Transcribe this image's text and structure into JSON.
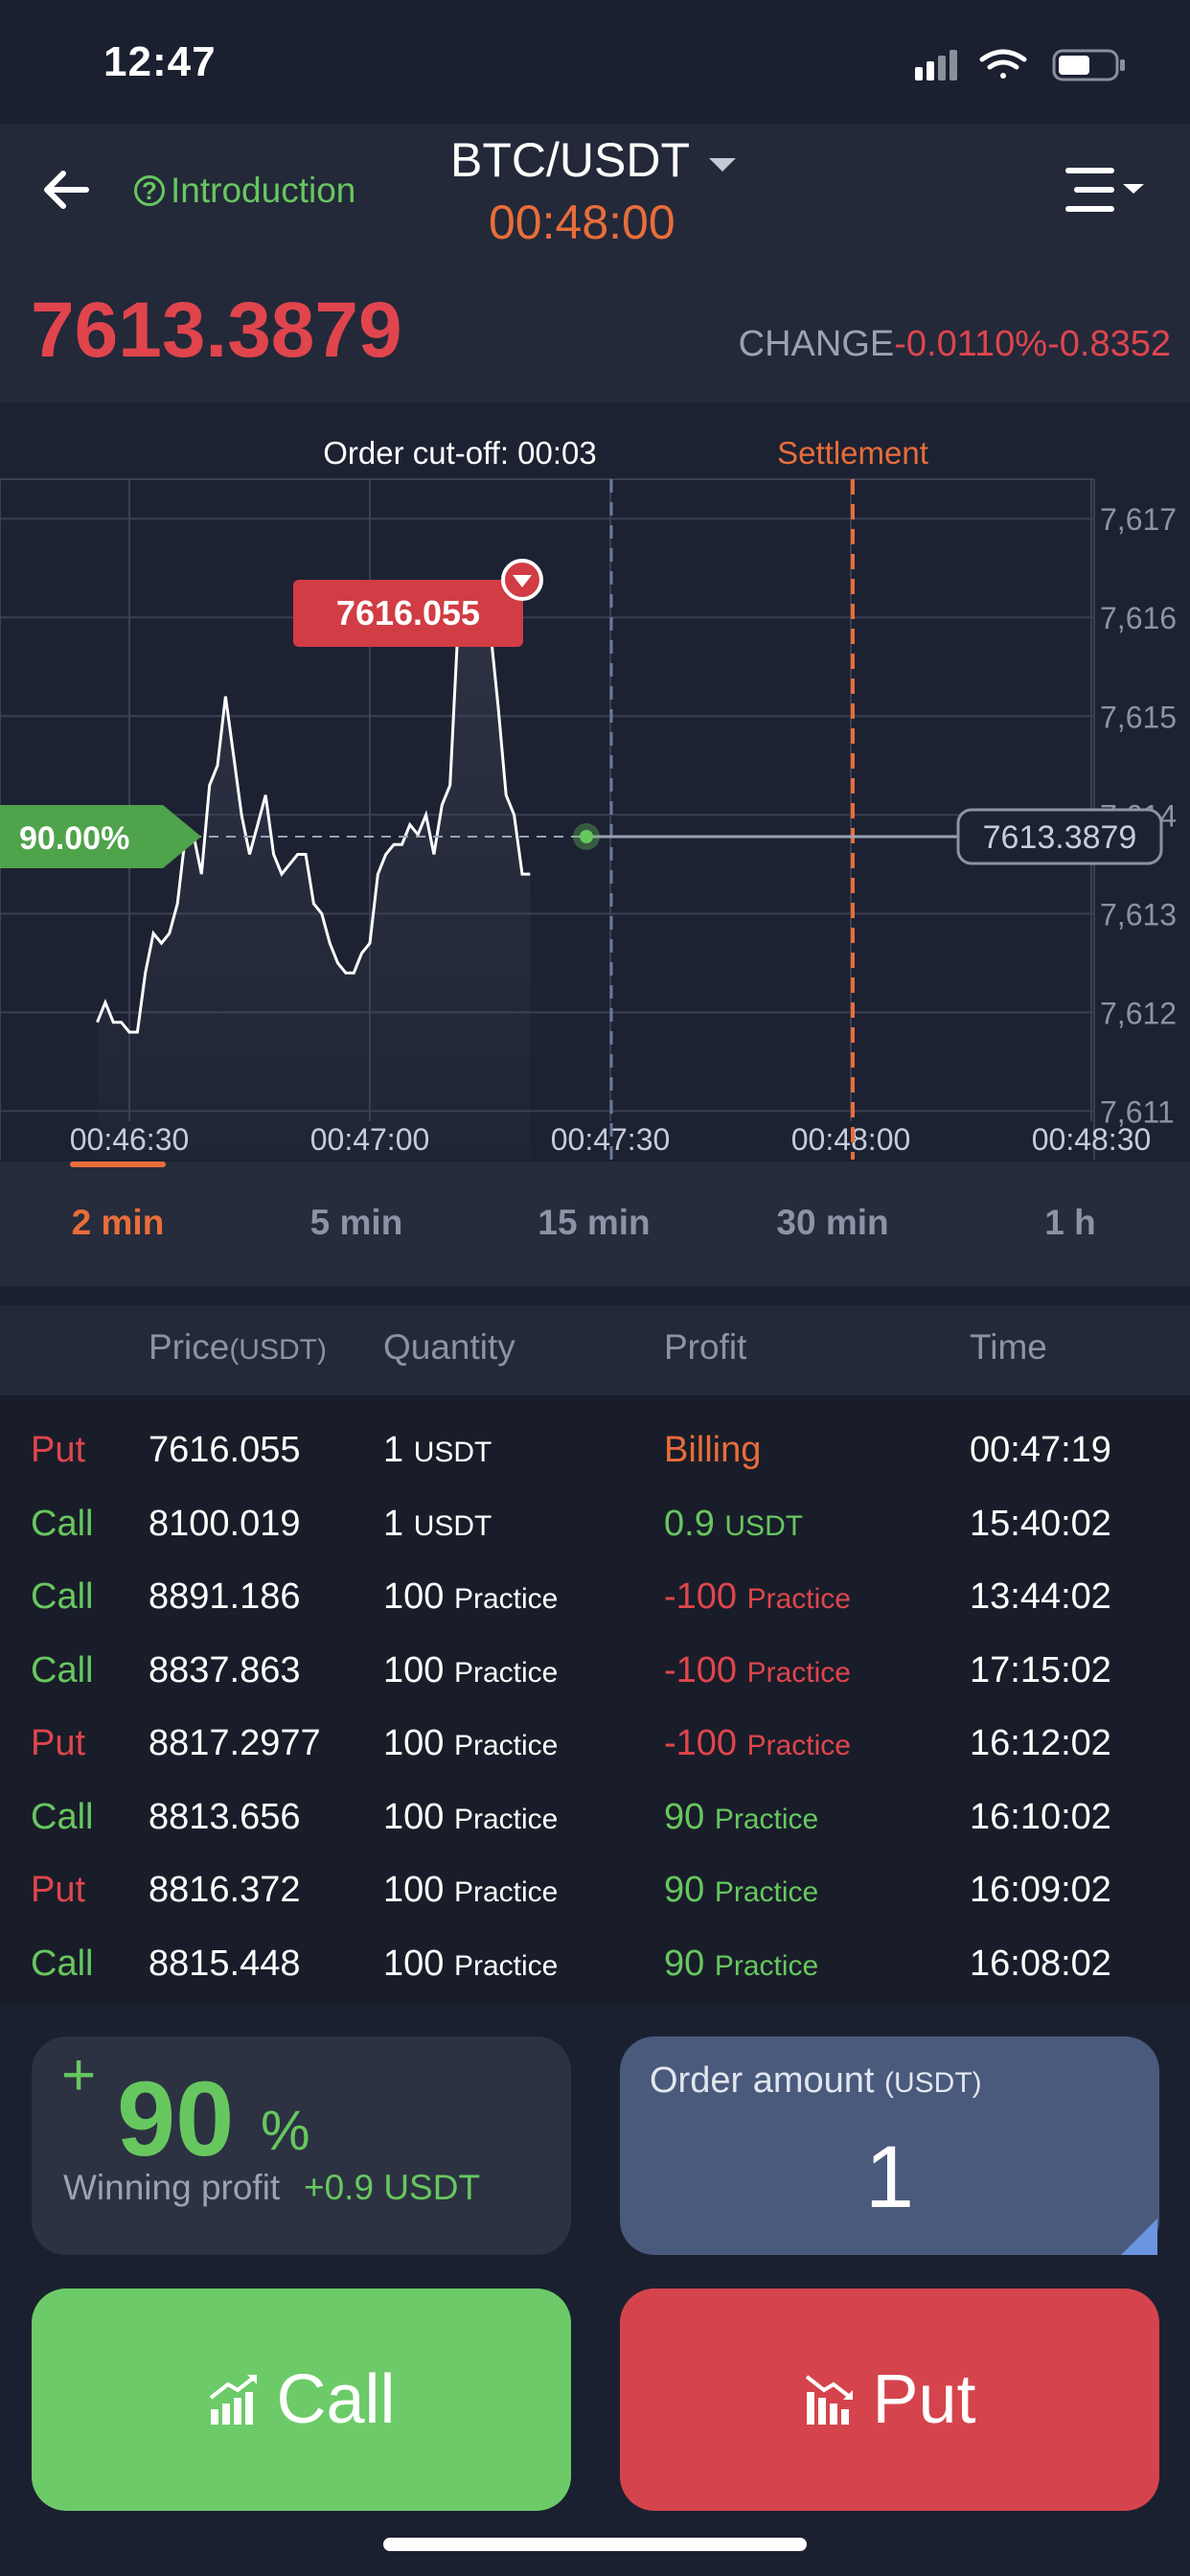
{
  "status_bar": {
    "time": "12:47"
  },
  "header": {
    "intro_label": "Introduction",
    "pair": "BTC/USDT",
    "countdown": "00:48:00",
    "price": "7613.3879",
    "change_label": "CHANGE",
    "change_pct": "-0.0110%",
    "change_abs": "-0.8352"
  },
  "chart": {
    "cutoff_label": "Order cut-off: 00:03",
    "settlement_label": "Settlement",
    "peak_label": "7616.055",
    "payout_label": "90.00%",
    "current_label": "7613.3879",
    "y_ticks": [
      "7,617",
      "7,616",
      "7,615",
      "7,614",
      "7,613",
      "7,612",
      "7,611"
    ],
    "x_ticks": [
      "00:46:30",
      "00:47:00",
      "00:47:30",
      "00:48:00",
      "00:48:30"
    ]
  },
  "chart_data": {
    "type": "line",
    "x": [
      "00:46:26",
      "00:46:27",
      "00:46:28",
      "00:46:29",
      "00:46:30",
      "00:46:31",
      "00:46:32",
      "00:46:33",
      "00:46:34",
      "00:46:35",
      "00:46:36",
      "00:46:37",
      "00:46:38",
      "00:46:39",
      "00:46:40",
      "00:46:41",
      "00:46:42",
      "00:46:43",
      "00:46:44",
      "00:46:45",
      "00:46:46",
      "00:46:47",
      "00:46:48",
      "00:46:49",
      "00:46:50",
      "00:46:51",
      "00:46:52",
      "00:46:53",
      "00:46:54",
      "00:46:55",
      "00:46:56",
      "00:46:57",
      "00:46:58",
      "00:46:59",
      "00:47:00",
      "00:47:01",
      "00:47:02",
      "00:47:03",
      "00:47:04",
      "00:47:05",
      "00:47:06",
      "00:47:07",
      "00:47:08",
      "00:47:09",
      "00:47:10",
      "00:47:11",
      "00:47:12",
      "00:47:13",
      "00:47:14",
      "00:47:15",
      "00:47:16",
      "00:47:17",
      "00:47:18",
      "00:47:19",
      "00:47:20",
      "00:47:21",
      "00:47:22",
      "00:47:23",
      "00:47:24",
      "00:47:25",
      "00:47:26",
      "00:47:27"
    ],
    "values": [
      7611.9,
      7612.1,
      7611.9,
      7611.9,
      7611.8,
      7611.8,
      7612.4,
      7612.8,
      7612.7,
      7612.8,
      7613.1,
      7613.8,
      7613.8,
      7613.4,
      7614.3,
      7614.5,
      7615.2,
      7614.6,
      7614.0,
      7613.6,
      7613.9,
      7614.2,
      7613.6,
      7613.4,
      7613.5,
      7613.6,
      7613.6,
      7613.1,
      7613.0,
      7612.7,
      7612.5,
      7612.4,
      7612.4,
      7612.6,
      7612.7,
      7613.4,
      7613.6,
      7613.7,
      7613.7,
      7613.9,
      7613.8,
      7614.0,
      7613.6,
      7614.1,
      7614.3,
      7615.9,
      7616.0,
      7616.1,
      7616.0,
      7615.9,
      7615.1,
      7614.2,
      7614.0,
      7613.4,
      7613.4,
      7613.4,
      7613.4,
      7613.4,
      7613.4,
      7613.4,
      7613.4,
      7613.4
    ],
    "ylim": [
      7610.8,
      7617.4
    ],
    "grid": true
  },
  "intervals": {
    "active": 0,
    "tabs": [
      {
        "label": "2 min"
      },
      {
        "label": "5 min"
      },
      {
        "label": "15 min"
      },
      {
        "label": "30 min"
      },
      {
        "label": "1 h"
      }
    ]
  },
  "orders": {
    "headers": {
      "price": "Price",
      "price_unit": "(USDT)",
      "quantity": "Quantity",
      "profit": "Profit",
      "time": "Time"
    },
    "rows": [
      {
        "type": "Put",
        "type_color": "#e0454d",
        "price": "7616.055",
        "qty": "1",
        "qty_unit": "USDT",
        "profit": "Billing",
        "profit_unit": "",
        "profit_color": "#e96d3a",
        "time": "00:47:19"
      },
      {
        "type": "Call",
        "type_color": "#67c75f",
        "price": "8100.019",
        "qty": "1",
        "qty_unit": "USDT",
        "profit": "0.9",
        "profit_unit": "USDT",
        "profit_color": "#67c75f",
        "time": "15:40:02"
      },
      {
        "type": "Call",
        "type_color": "#67c75f",
        "price": "8891.186",
        "qty": "100",
        "qty_unit": "Practice",
        "profit": "-100",
        "profit_unit": "Practice",
        "profit_color": "#e0454d",
        "time": "13:44:02"
      },
      {
        "type": "Call",
        "type_color": "#67c75f",
        "price": "8837.863",
        "qty": "100",
        "qty_unit": "Practice",
        "profit": "-100",
        "profit_unit": "Practice",
        "profit_color": "#e0454d",
        "time": "17:15:02"
      },
      {
        "type": "Put",
        "type_color": "#e0454d",
        "price": "8817.2977",
        "qty": "100",
        "qty_unit": "Practice",
        "profit": "-100",
        "profit_unit": "Practice",
        "profit_color": "#e0454d",
        "time": "16:12:02"
      },
      {
        "type": "Call",
        "type_color": "#67c75f",
        "price": "8813.656",
        "qty": "100",
        "qty_unit": "Practice",
        "profit": "90",
        "profit_unit": "Practice",
        "profit_color": "#67c75f",
        "time": "16:10:02"
      },
      {
        "type": "Put",
        "type_color": "#e0454d",
        "price": "8816.372",
        "qty": "100",
        "qty_unit": "Practice",
        "profit": "90",
        "profit_unit": "Practice",
        "profit_color": "#67c75f",
        "time": "16:09:02"
      },
      {
        "type": "Call",
        "type_color": "#67c75f",
        "price": "8815.448",
        "qty": "100",
        "qty_unit": "Practice",
        "profit": "90",
        "profit_unit": "Practice",
        "profit_color": "#67c75f",
        "time": "16:08:02"
      }
    ]
  },
  "trade": {
    "profit_plus": "+",
    "profit_value": "90",
    "profit_pct": "%",
    "winning_label": "Winning profit",
    "winning_amount": "+0.9 USDT",
    "amount_label": "Order amount",
    "amount_unit": "(USDT)",
    "amount_value": "1",
    "call_label": "Call",
    "put_label": "Put"
  },
  "icons": {
    "back": "arrow-left-icon",
    "intro": "question-circle-icon",
    "menu": "menu-list-icon",
    "call": "chart-up-icon",
    "put": "chart-down-icon"
  },
  "colors": {
    "accent_orange": "#e96d3a",
    "green": "#67c75f",
    "red": "#e0454d",
    "call_button": "#6ccb68",
    "put_button": "#d5444c",
    "amount_card": "#4a5a7c"
  }
}
